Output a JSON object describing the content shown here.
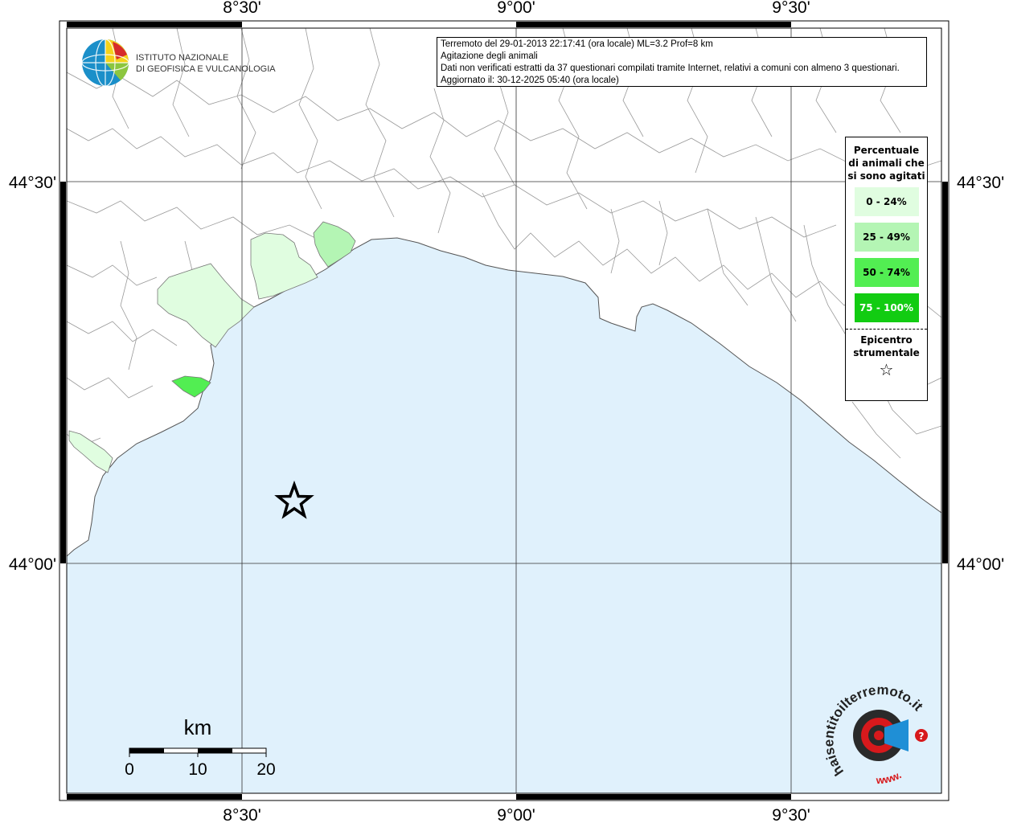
{
  "info": {
    "line1": "Terremoto del 29-01-2013 22:17:41 (ora locale) ML=3.2 Prof=8 km",
    "line2": "Agitazione degli animali",
    "line3": "Dati non verificati estratti da 37 questionari compilati tramite Internet, relativi a comuni con almeno 3 questionari.",
    "line4": "Aggiornato il: 30-12-2025 05:40 (ora locale)"
  },
  "institute": {
    "name_line1": "ISTITUTO NAZIONALE",
    "name_line2": "DI GEOFISICA E VULCANOLOGIA"
  },
  "axes": {
    "lon_top": [
      "8°30'",
      "9°00'",
      "9°30'"
    ],
    "lon_bottom": [
      "8°30'",
      "9°00'",
      "9°30'"
    ],
    "lat_left": [
      "44°30'",
      "44°00'"
    ],
    "lat_right": [
      "44°30'",
      "44°00'"
    ]
  },
  "legend": {
    "title": "Percentuale di animali che si sono agitati",
    "classes": [
      {
        "label": "0 - 24%",
        "color": "#e0fde0"
      },
      {
        "label": "25 - 49%",
        "color": "#b4f5b4"
      },
      {
        "label": "50 - 74%",
        "color": "#52ee52"
      },
      {
        "label": "75 - 100%",
        "color": "#12cc12"
      }
    ],
    "epicenter_title": "Epicentro strumentale",
    "epicenter_symbol": "☆"
  },
  "scalebar": {
    "unit": "km",
    "ticks": [
      "0",
      "10",
      "20"
    ]
  },
  "logo": {
    "site": "haisentitoilterremoto.it",
    "prefix": "www."
  },
  "colors": {
    "sea": "#e0f1fc",
    "land": "#ffffff",
    "borders": "#9a9a9a",
    "frame": "#000000"
  }
}
